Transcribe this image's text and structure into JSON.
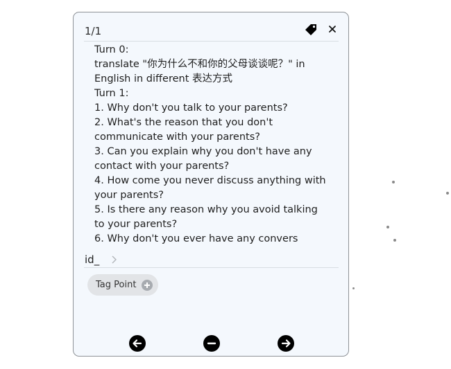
{
  "header": {
    "counter": "1/1"
  },
  "content": {
    "lines": [
      "Turn 0:",
      "translate \"你为什么不和你的父母谈谈呢？\" in English in different 表达方式",
      "Turn 1:",
      "1. Why don't you talk to your parents?",
      "2. What's the reason that you don't communicate with your parents?",
      "3. Can you explain why you don't have any contact with your parents?",
      "4. How come you never discuss anything with your parents?",
      "5. Is there any reason why you avoid talking to your parents?",
      "6. Why don't you ever have any convers"
    ]
  },
  "id_row": {
    "label": "id_"
  },
  "tag_point": {
    "label": "Tag Point"
  },
  "icons": {
    "tag": "tag-icon",
    "close": "close-icon",
    "chevron": "chevron-right-icon",
    "plus": "plus-icon",
    "prev": "arrow-left-icon",
    "remove": "minus-icon",
    "next": "arrow-right-icon"
  }
}
